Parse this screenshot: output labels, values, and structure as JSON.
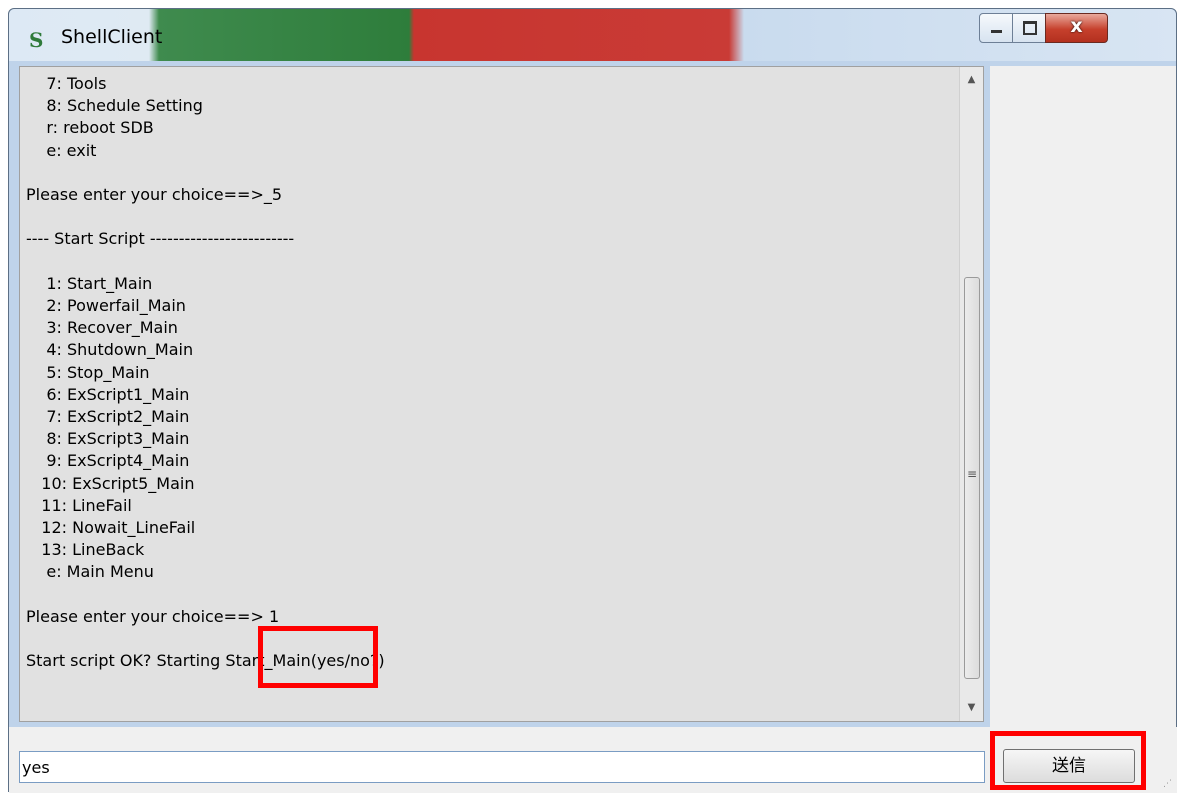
{
  "window": {
    "title": "ShellClient",
    "close_glyph": "x"
  },
  "console": {
    "lines": [
      "    7: Tools",
      "    8: Schedule Setting",
      "    r: reboot SDB",
      "    e: exit",
      "",
      "Please enter your choice==>_5",
      "",
      "---- Start Script -------------------------",
      "",
      "    1: Start_Main",
      "    2: Powerfail_Main",
      "    3: Recover_Main",
      "    4: Shutdown_Main",
      "    5: Stop_Main",
      "    6: ExScript1_Main",
      "    7: ExScript2_Main",
      "    8: ExScript3_Main",
      "    9: ExScript4_Main",
      "   10: ExScript5_Main",
      "   11: LineFail",
      "   12: Nowait_LineFail",
      "   13: LineBack",
      "    e: Main Menu",
      "",
      "Please enter your choice==> 1",
      "",
      "Start script OK? Starting Start_Main(yes/no?)"
    ]
  },
  "input": {
    "value": "yes"
  },
  "send_button": {
    "label": "送信"
  },
  "icons": {
    "app": "app-logo-icon",
    "minimize": "minimize-icon",
    "maximize": "maximize-icon",
    "close": "close-icon",
    "scroll_up": "scroll-up-arrow-icon",
    "scroll_down": "scroll-down-arrow-icon",
    "grip": "resize-grip-icon"
  },
  "colors": {
    "highlight": "#ff0000",
    "console_bg": "#e1e1e1"
  }
}
